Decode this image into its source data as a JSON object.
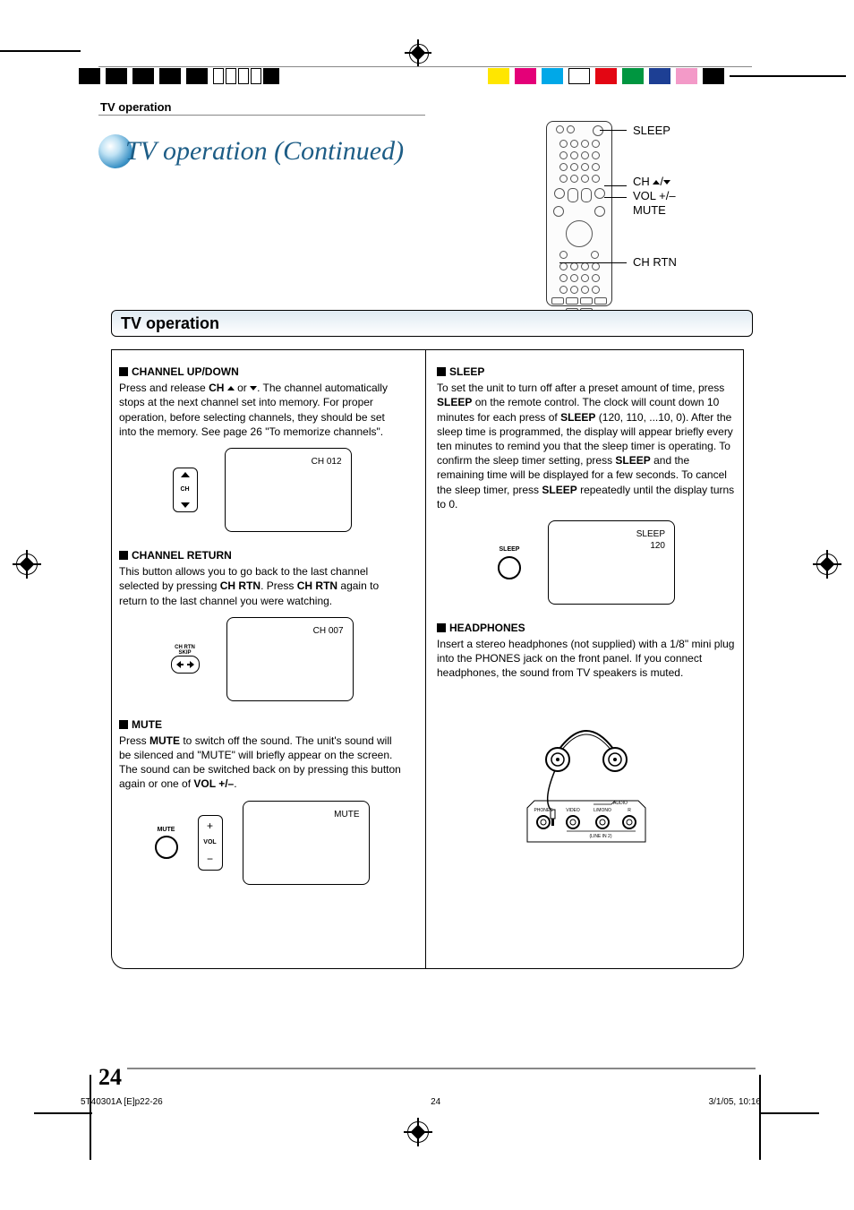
{
  "header": {
    "breadcrumb": "TV operation",
    "title": "TV operation (Continued)",
    "section": "TV operation"
  },
  "remote_labels": {
    "sleep": "SLEEP",
    "ch": "CH ",
    "vol": "VOL +/–",
    "mute": "MUTE",
    "chrtn": "CH RTN"
  },
  "left": {
    "channel_updown": {
      "head": "CHANNEL UP/DOWN",
      "p1a": "Press and release ",
      "p1b": "CH",
      "p1c": " or ",
      "p1d": ". The channel automatically stops at the next channel set into memory. For proper operation, before selecting channels, they should be set into the memory. See page 26 \"To memorize channels\".",
      "btn_label": "CH",
      "screen": "CH 012"
    },
    "channel_return": {
      "head": "CHANNEL RETURN",
      "p1a": "This button allows you to go back to the last channel selected by pressing ",
      "p1b": "CH RTN",
      "p1c": ". Press ",
      "p1d": "CH RTN",
      "p1e": " again to return to the last channel you were watching.",
      "btn_line1": "CH RTN",
      "btn_line2": "SKIP",
      "screen": "CH 007"
    },
    "mute": {
      "head": "MUTE",
      "p1a": "Press ",
      "p1b": "MUTE",
      "p1c": " to switch off the sound. The unit's sound will be silenced and \"MUTE\" will briefly appear on the screen. The sound can be switched back on by pressing this button again or one of ",
      "p1d": "VOL +/–",
      "p1e": ".",
      "btn_caption": "MUTE",
      "vol_label": "VOL",
      "screen": "MUTE"
    }
  },
  "right": {
    "sleep": {
      "head": "SLEEP",
      "p1a": "To set the unit to turn off after a preset amount of time, press ",
      "p1b": "SLEEP",
      "p1c": " on the remote control. The clock will count down 10 minutes for each press of ",
      "p1d": "SLEEP",
      "p1e": " (120, 110, ...10, 0). After the sleep time is programmed, the display will appear briefly every ten minutes to remind you that the sleep timer is operating. To confirm the sleep timer setting, press ",
      "p1f": "SLEEP",
      "p1g": " and the remaining time will be displayed for a few seconds. To cancel the sleep timer, press ",
      "p1h": "SLEEP",
      "p1i": " repeatedly until the display turns to 0.",
      "btn_caption": "SLEEP",
      "screen_l1": "SLEEP",
      "screen_l2": "120"
    },
    "headphones": {
      "head": "HEADPHONES",
      "p": "Insert a stereo headphones (not supplied) with a 1/8\" mini plug into the PHONES jack on the front panel. If you connect headphones, the sound from TV speakers is muted.",
      "jack_labels": {
        "phones": "PHONES",
        "video": "VIDEO",
        "lmono": "L/MONO",
        "r": "R",
        "audio": "AUDIO",
        "line": "(LINE IN 2)"
      }
    }
  },
  "page_number": "24",
  "footer": {
    "left": "5T40301A [E]p22-26",
    "mid": "24",
    "right": "3/1/05, 10:16"
  }
}
